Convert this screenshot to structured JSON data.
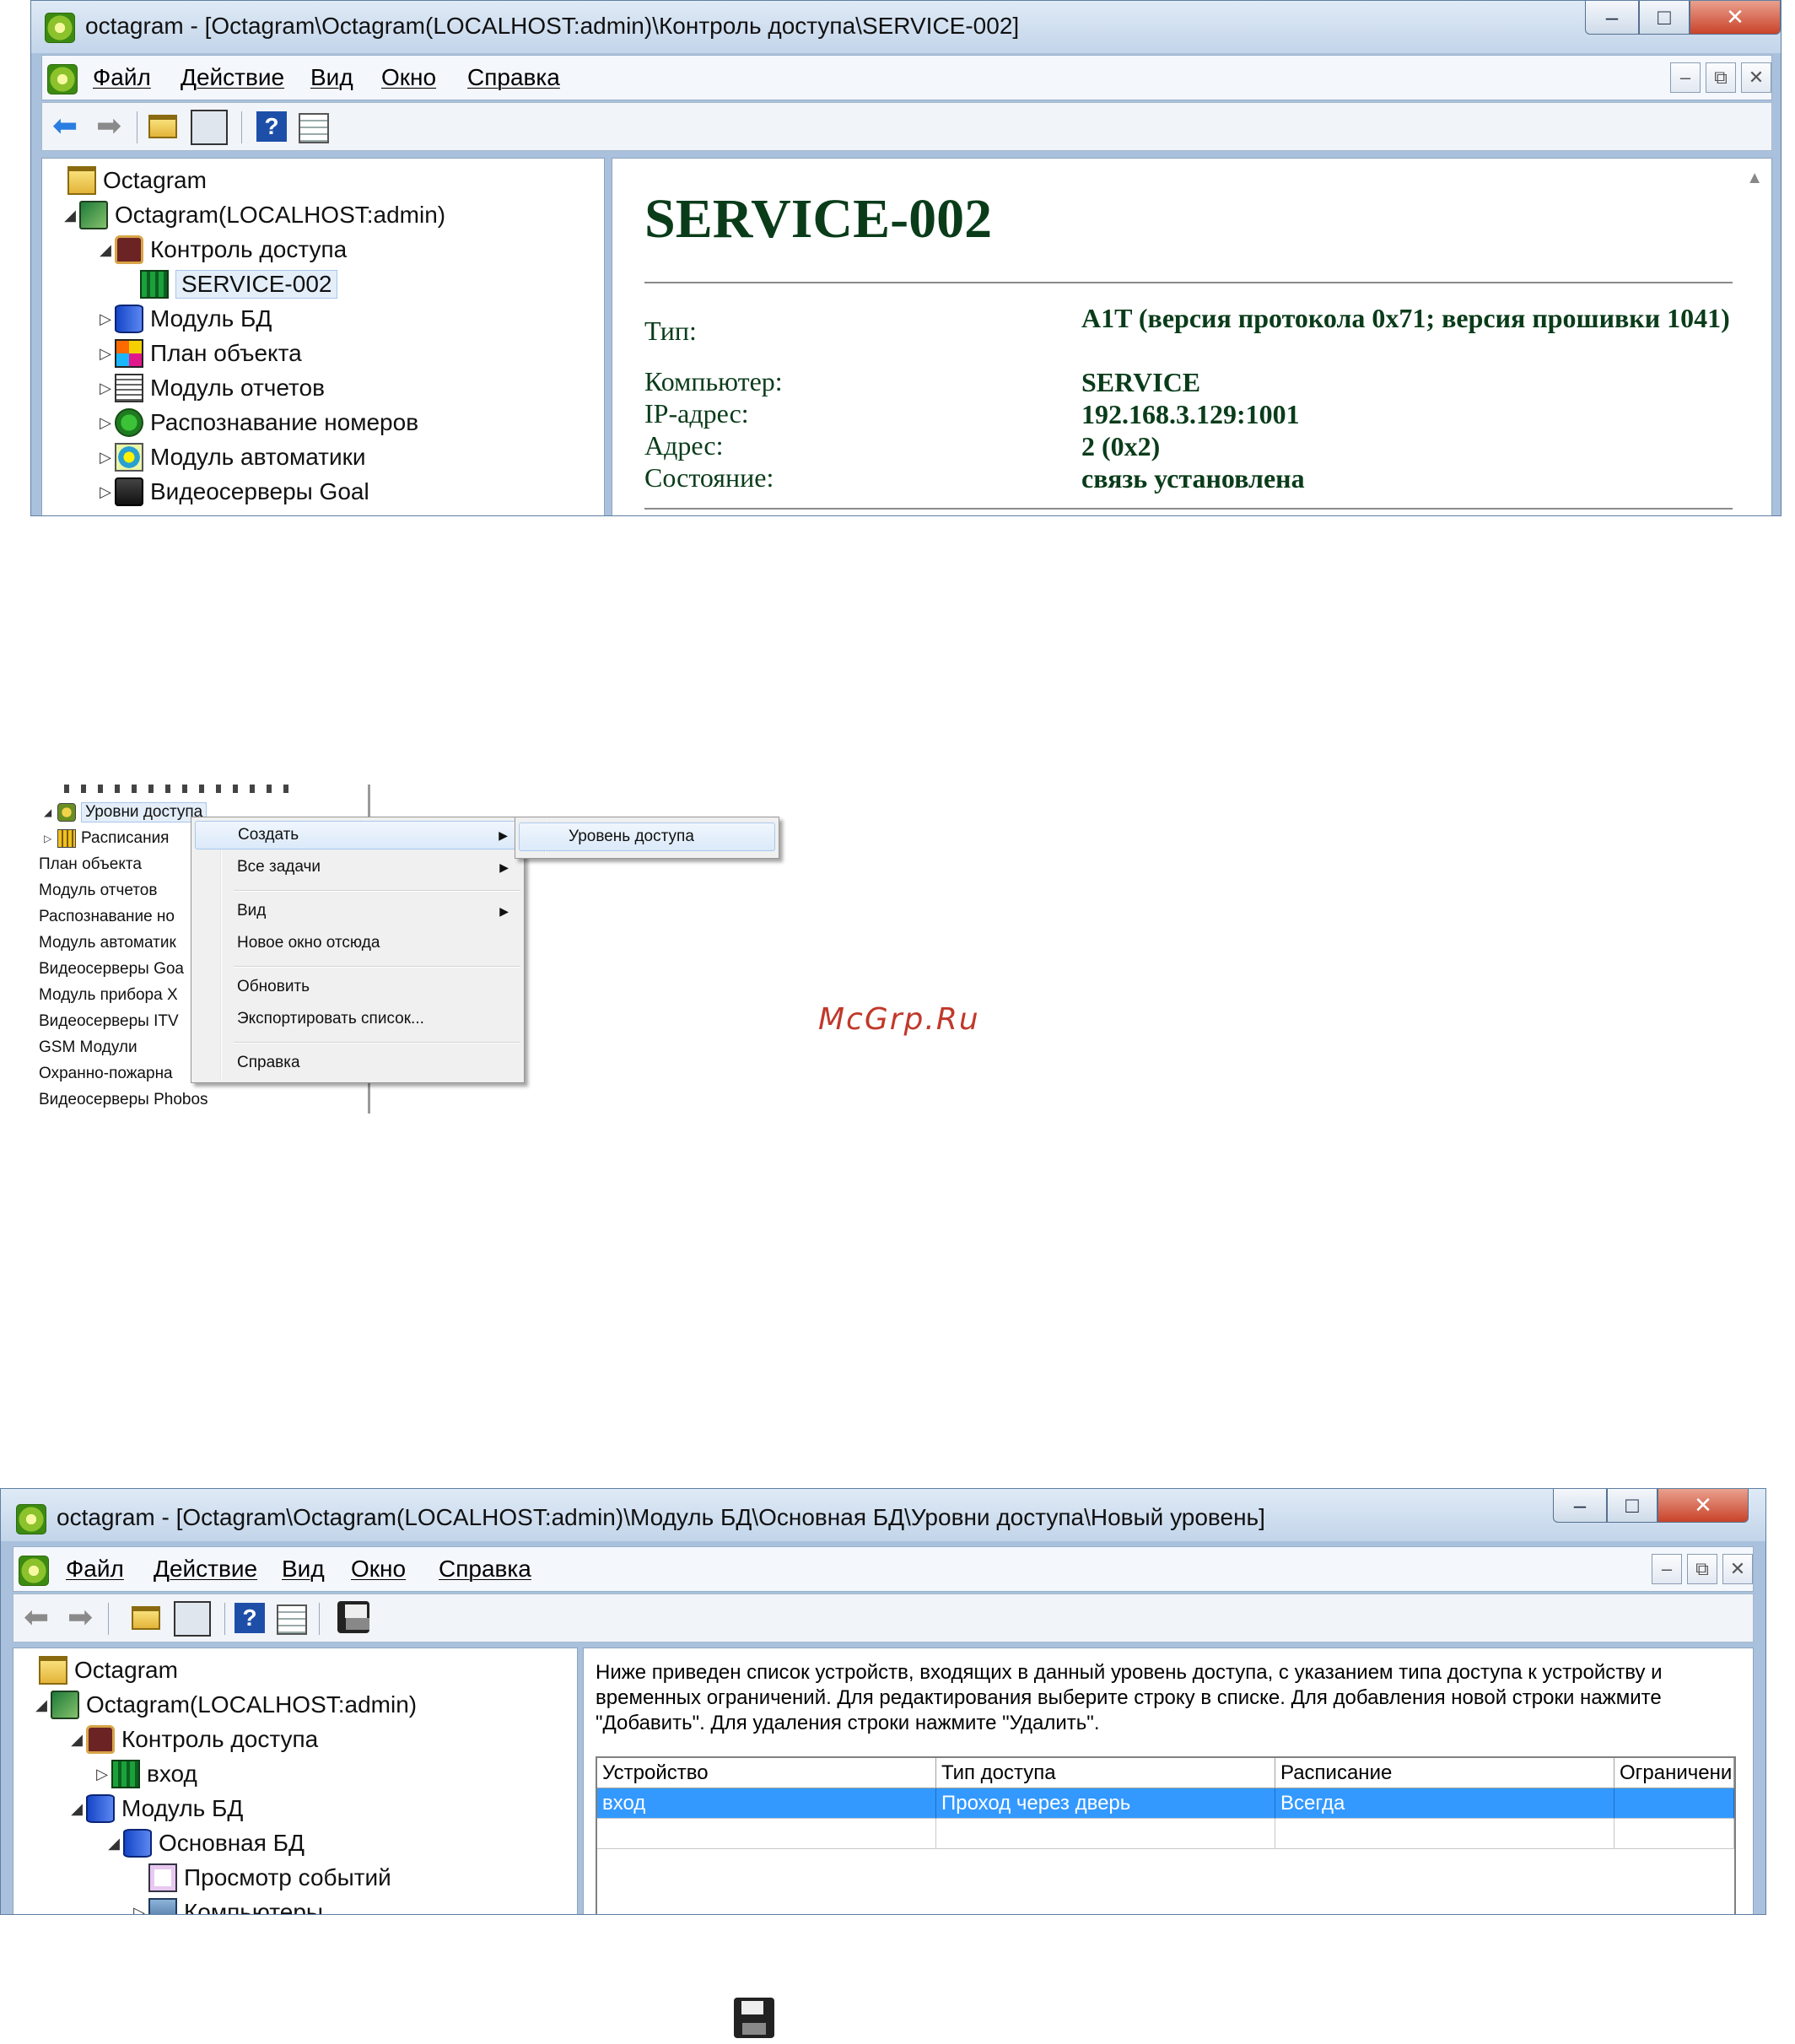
{
  "window1": {
    "title": "octagram - [Octagram\\Octagram(LOCALHOST:admin)\\Контроль доступа\\SERVICE-002]",
    "menu": [
      "Файл",
      "Действие",
      "Вид",
      "Окно",
      "Справка"
    ],
    "tree": [
      {
        "label": "Octagram",
        "icon": "folder-icon",
        "expander": ""
      },
      {
        "label": "Octagram(LOCALHOST:admin)",
        "icon": "server-icon",
        "expander": "◢"
      },
      {
        "label": "Контроль доступа",
        "icon": "lock-icon",
        "expander": "◢"
      },
      {
        "label": "SERVICE-002",
        "icon": "door-controller-icon",
        "expander": ""
      },
      {
        "label": "Модуль БД",
        "icon": "database-icon",
        "expander": "▷"
      },
      {
        "label": "План объекта",
        "icon": "plan-icon",
        "expander": "▷"
      },
      {
        "label": "Модуль отчетов",
        "icon": "report-icon",
        "expander": "▷"
      },
      {
        "label": "Распознавание номеров",
        "icon": "car-icon",
        "expander": "▷"
      },
      {
        "label": "Модуль автоматики",
        "icon": "automation-icon",
        "expander": "▷"
      },
      {
        "label": "Видеосерверы Goal",
        "icon": "camera-icon",
        "expander": "▷"
      }
    ],
    "device": {
      "name": "SERVICE-002",
      "props": [
        {
          "key": "Тип:",
          "value": "A1T (версия протокола 0x71; версия прошивки 1041)"
        },
        {
          "key": "Компьютер:",
          "value": "SERVICE"
        },
        {
          "key": "IP-адрес:",
          "value": "192.168.3.129:1001"
        },
        {
          "key": "Адрес:",
          "value": "2 (0x2)"
        },
        {
          "key": "Состояние:",
          "value": "связь установлена"
        }
      ]
    }
  },
  "context": {
    "tree": [
      {
        "label": "Уровни доступа",
        "expander": "◢"
      },
      {
        "label": "Расписания",
        "expander": "▷"
      },
      {
        "label": "План объекта",
        "expander": ""
      },
      {
        "label": "Модуль отчетов",
        "expander": ""
      },
      {
        "label": "Распознавание но",
        "expander": ""
      },
      {
        "label": "Модуль автоматик",
        "expander": ""
      },
      {
        "label": "Видеосерверы Goa",
        "expander": ""
      },
      {
        "label": "Модуль прибора Х",
        "expander": ""
      },
      {
        "label": "Видеосерверы ITV",
        "expander": ""
      },
      {
        "label": "GSM Модули",
        "expander": ""
      },
      {
        "label": "Охранно-пожарна",
        "expander": ""
      },
      {
        "label": "Видеосерверы Phobos",
        "expander": ""
      }
    ],
    "menu": {
      "create": "Создать",
      "all_tasks": "Все задачи",
      "view": "Вид",
      "new_window": "Новое окно отсюда",
      "refresh": "Обновить",
      "export": "Экспортировать список...",
      "help": "Справка"
    },
    "submenu": {
      "access_level": "Уровень доступа"
    },
    "watermark": "McGrp.Ru"
  },
  "window2": {
    "title": "octagram - [Octagram\\Octagram(LOCALHOST:admin)\\Модуль БД\\Основная БД\\Уровни доступа\\Новый уровень]",
    "menu": [
      "Файл",
      "Действие",
      "Вид",
      "Окно",
      "Справка"
    ],
    "tree": [
      {
        "label": "Octagram",
        "icon": "folder-icon",
        "expander": ""
      },
      {
        "label": "Octagram(LOCALHOST:admin)",
        "icon": "server-icon",
        "expander": "◢"
      },
      {
        "label": "Контроль доступа",
        "icon": "lock-icon",
        "expander": "◢"
      },
      {
        "label": "вход",
        "icon": "door-controller-icon",
        "expander": "▷"
      },
      {
        "label": "Модуль БД",
        "icon": "database-icon",
        "expander": "◢"
      },
      {
        "label": "Основная БД",
        "icon": "database-icon",
        "expander": "◢"
      },
      {
        "label": "Просмотр событий",
        "icon": "events-icon",
        "expander": ""
      },
      {
        "label": "Компьютеры",
        "icon": "computers-icon",
        "expander": "▷"
      }
    ],
    "description": "Ниже приведен список устройств, входящих в данный уровень доступа, с указанием типа доступа к устройству и временных ограничений. Для редактирования выберите строку в списке. Для добавления новой строки нажмите \"Добавить\". Для удаления строки нажмите \"Удалить\".",
    "table": {
      "headers": [
        "Устройство",
        "Тип доступа",
        "Расписание",
        "Ограничени"
      ],
      "rows": [
        [
          "вход",
          "Проход через дверь",
          "Всегда",
          ""
        ]
      ]
    }
  }
}
